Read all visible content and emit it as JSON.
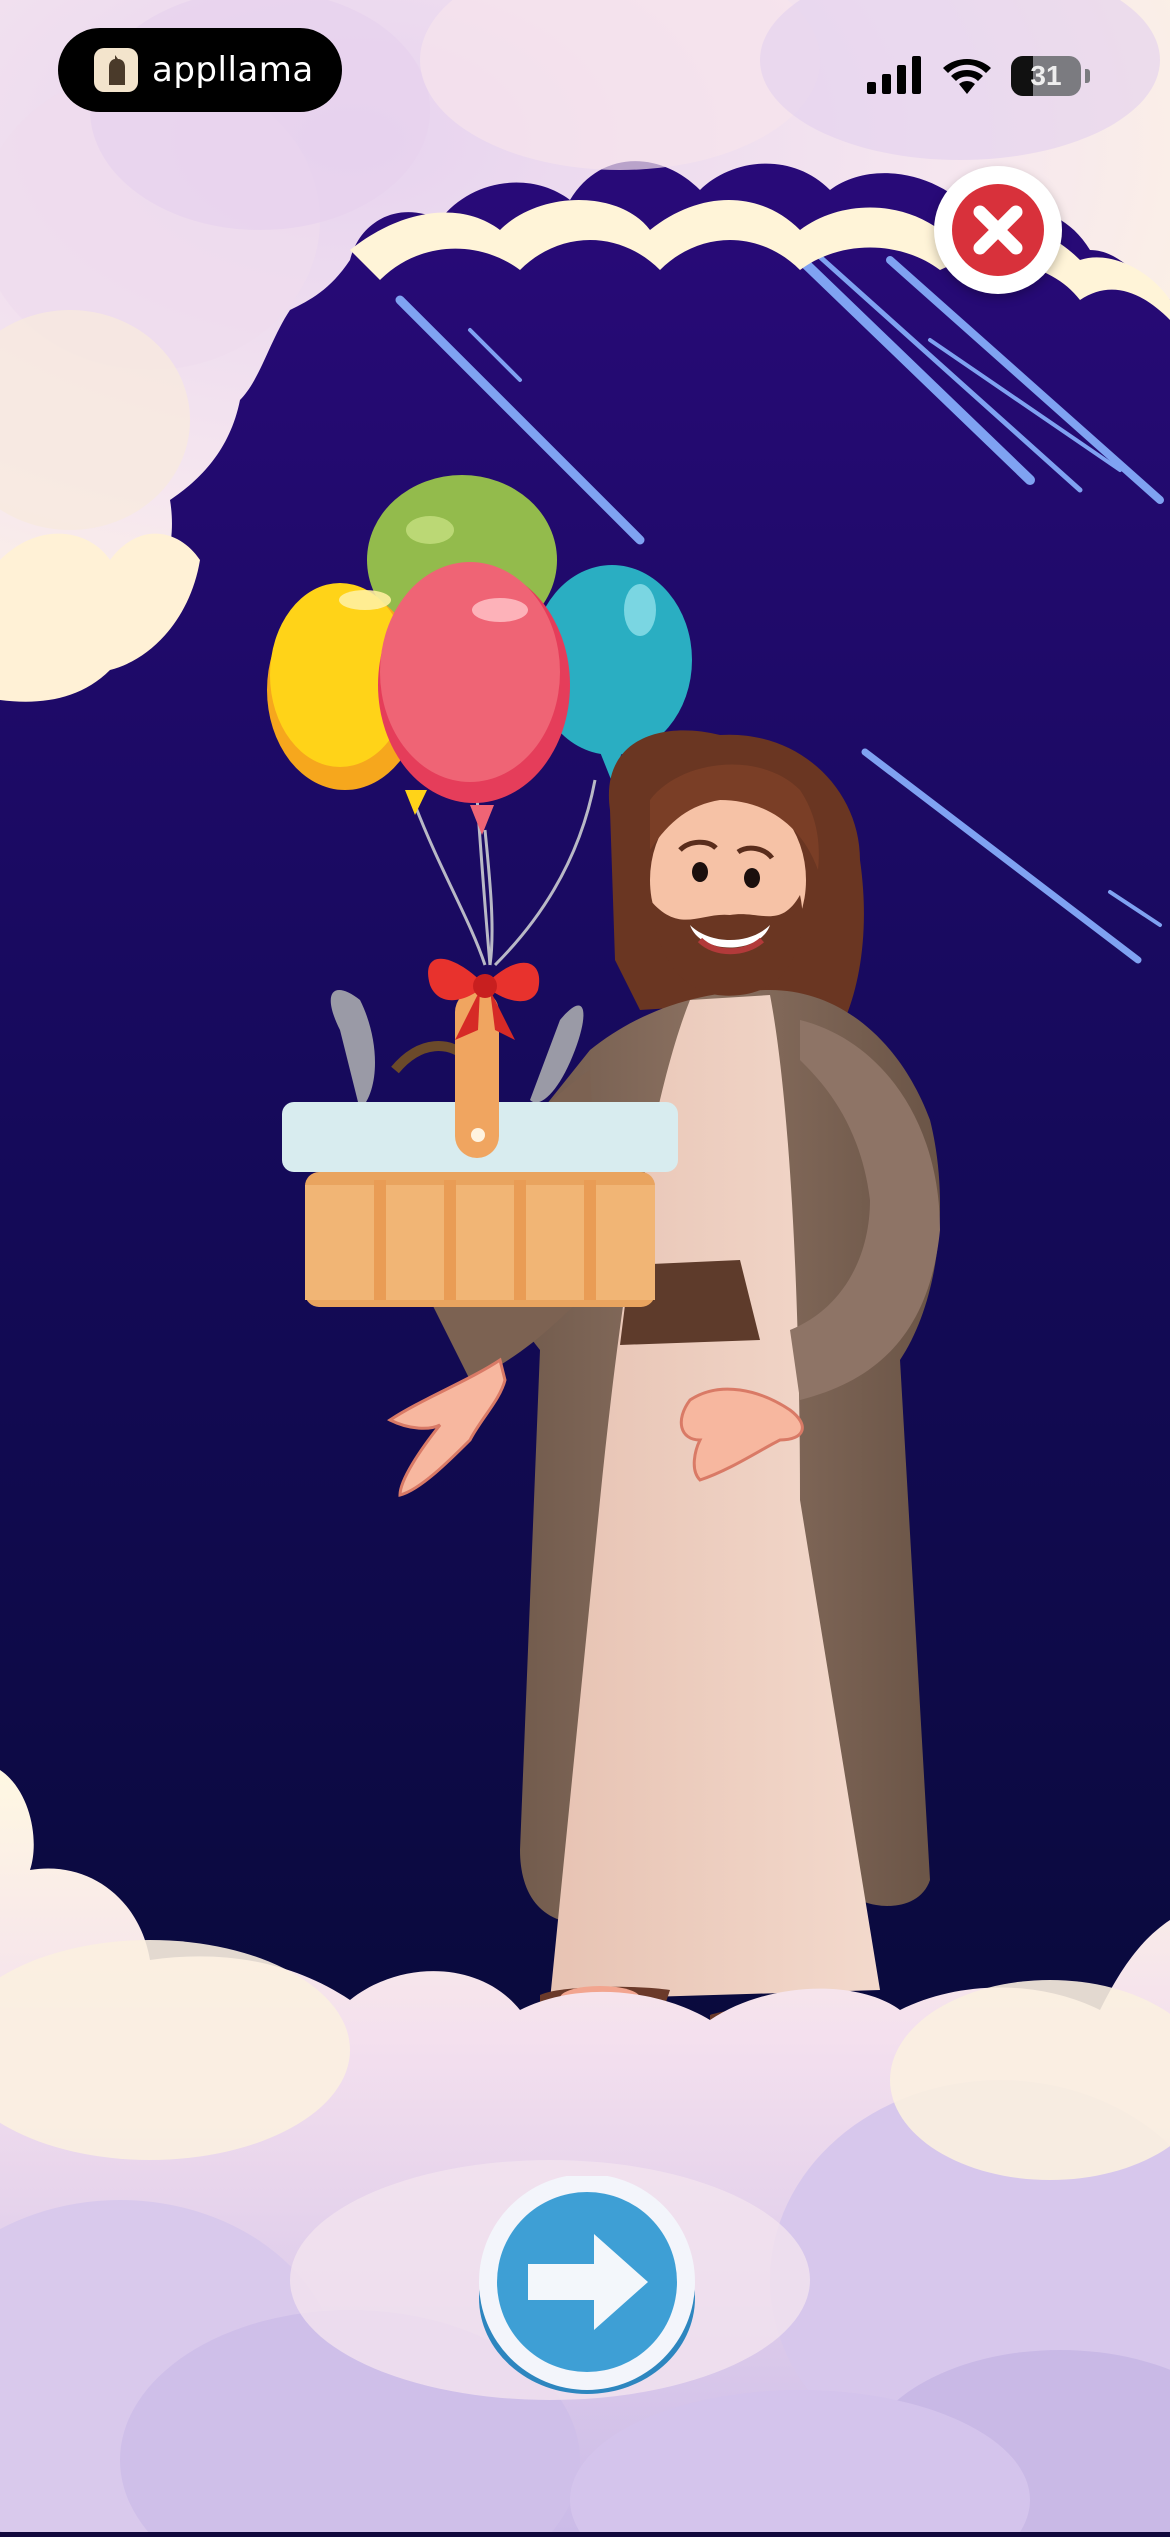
{
  "status_bar": {
    "app_name": "appllama",
    "battery": "31",
    "icons": [
      "signal-icon",
      "wifi-icon",
      "battery-icon"
    ]
  },
  "buttons": {
    "close": "close-icon",
    "next": "arrow-right-icon"
  },
  "scene": {
    "description_icons": [
      "clouds",
      "balloons",
      "gift-basket",
      "character"
    ],
    "colors": {
      "sky_top": "#2a0a78",
      "sky_bottom": "#040b2e",
      "cloud": "#fff6df",
      "cloud_shadow": "#d8c7ea",
      "close_red": "#d8313b",
      "next_blue": "#3ea0d6"
    }
  }
}
